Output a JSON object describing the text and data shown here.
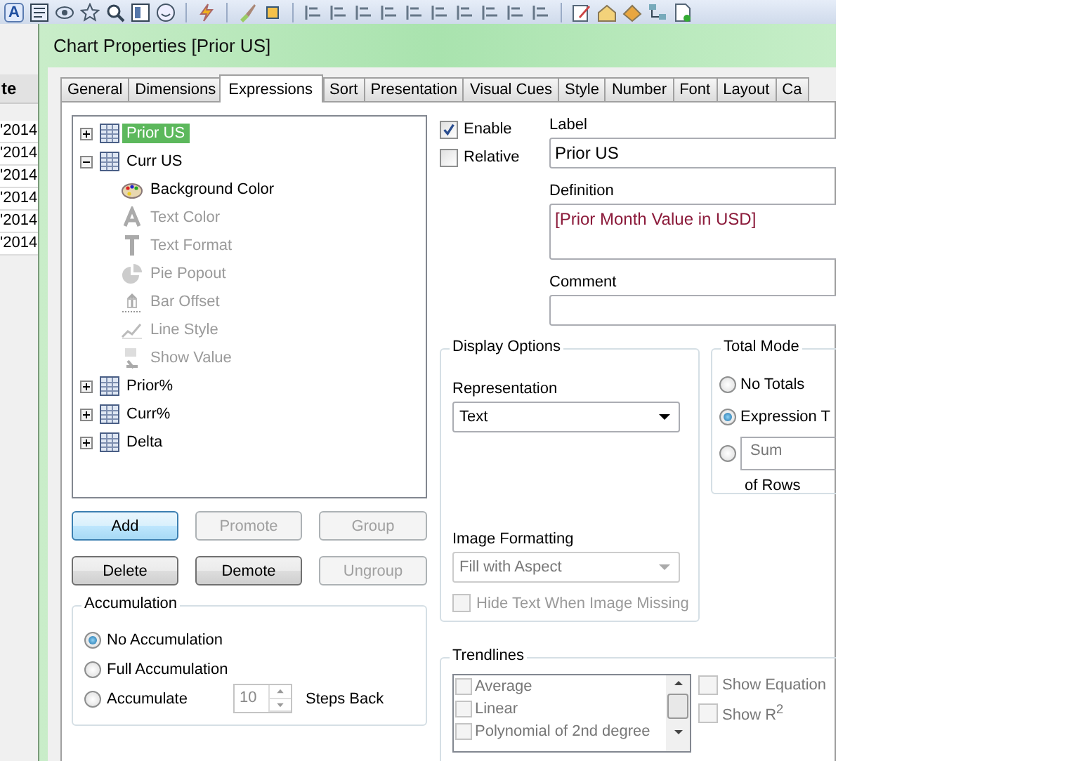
{
  "toolbar": {
    "font_button": "A"
  },
  "background_table": {
    "header": "te",
    "rows": [
      "'2014",
      "'2014",
      "'2014",
      "'2014",
      "'2014",
      "'2014"
    ]
  },
  "window": {
    "title": "Chart Properties [Prior US]"
  },
  "tabs": [
    {
      "label": "General",
      "selected": false
    },
    {
      "label": "Dimensions",
      "selected": false
    },
    {
      "label": "Expressions",
      "selected": true
    },
    {
      "label": "Sort",
      "selected": false
    },
    {
      "label": "Presentation",
      "selected": false
    },
    {
      "label": "Visual Cues",
      "selected": false
    },
    {
      "label": "Style",
      "selected": false
    },
    {
      "label": "Number",
      "selected": false
    },
    {
      "label": "Font",
      "selected": false
    },
    {
      "label": "Layout",
      "selected": false
    },
    {
      "label": "Ca",
      "selected": false
    }
  ],
  "expressions": [
    {
      "label": "Prior US",
      "selected": true,
      "expanded": false
    },
    {
      "label": "Curr US",
      "selected": false,
      "expanded": true,
      "children": [
        {
          "label": "Background Color",
          "kind": "palette",
          "disabled": false
        },
        {
          "label": "Text Color",
          "kind": "letter",
          "disabled": true
        },
        {
          "label": "Text Format",
          "kind": "format",
          "disabled": true
        },
        {
          "label": "Pie Popout",
          "kind": "pie",
          "disabled": true
        },
        {
          "label": "Bar Offset",
          "kind": "offset",
          "disabled": true
        },
        {
          "label": "Line Style",
          "kind": "line",
          "disabled": true
        },
        {
          "label": "Show Value",
          "kind": "value",
          "disabled": true
        }
      ]
    },
    {
      "label": "Prior%",
      "selected": false,
      "expanded": false
    },
    {
      "label": "Curr%",
      "selected": false,
      "expanded": false
    },
    {
      "label": "Delta",
      "selected": false,
      "expanded": false
    }
  ],
  "buttons": [
    {
      "label": "Add",
      "disabled": false
    },
    {
      "label": "Promote",
      "disabled": true
    },
    {
      "label": "Group",
      "disabled": true
    },
    {
      "label": "Delete",
      "disabled": false
    },
    {
      "label": "Demote",
      "disabled": false
    },
    {
      "label": "Ungroup",
      "disabled": true
    }
  ],
  "accumulation": {
    "title": "Accumulation",
    "options": [
      {
        "label": "No Accumulation",
        "selected": true
      },
      {
        "label": "Full Accumulation",
        "selected": false
      },
      {
        "label": "Accumulate",
        "selected": false
      }
    ],
    "steps": "10",
    "steps_label": "Steps Back"
  },
  "enable": {
    "label": "Enable",
    "checked": true
  },
  "relative": {
    "label": "Relative",
    "checked": false
  },
  "label_field": {
    "label": "Label",
    "value": "Prior US"
  },
  "definition": {
    "label": "Definition",
    "value": "[Prior Month Value in USD]"
  },
  "comment": {
    "label": "Comment"
  },
  "display_options": {
    "title": "Display Options",
    "representation_label": "Representation",
    "representation": "Text",
    "image_formatting_label": "Image Formatting",
    "image_formatting": "Fill with Aspect",
    "hide_text": {
      "label": "Hide Text When Image Missing",
      "checked": false,
      "disabled": true
    }
  },
  "total_mode": {
    "title": "Total Mode",
    "options": [
      {
        "label": "No Totals",
        "selected": false
      },
      {
        "label": "Expression T",
        "selected": true
      },
      {
        "kind": "dropdown",
        "value": "Sum",
        "selected": false
      }
    ],
    "suffix": "of Rows"
  },
  "trendlines": {
    "title": "Trendlines",
    "items": [
      {
        "label": "Average",
        "checked": false
      },
      {
        "label": "Linear",
        "checked": false
      },
      {
        "label": "Polynomial of 2nd degree",
        "checked": false
      }
    ],
    "options": [
      {
        "label": "Show Equation",
        "checked": false
      },
      {
        "label": "Show R$^{2}$",
        "checked": false
      }
    ]
  }
}
